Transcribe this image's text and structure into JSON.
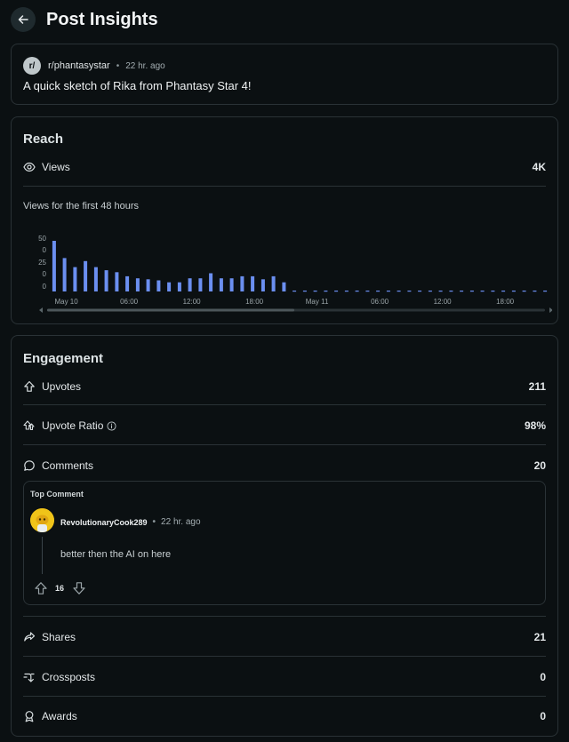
{
  "header": {
    "title": "Post Insights"
  },
  "post": {
    "subreddit": "r/phantasystar",
    "subreddit_icon": "r/",
    "separator": "•",
    "time": "22 hr. ago",
    "title": "A quick sketch of Rika from Phantasy Star 4!"
  },
  "reach": {
    "title": "Reach",
    "views_label": "Views",
    "views_value": "4K",
    "chart_caption": "Views for the first 48 hours"
  },
  "chart_data": {
    "type": "bar",
    "title": "Views for the first 48 hours",
    "y_ticks": [
      "50",
      "0",
      "25",
      "0",
      "0"
    ],
    "x_tick_labels": [
      "May 10",
      "06:00",
      "12:00",
      "18:00",
      "May 11",
      "06:00",
      "12:00",
      "18:00"
    ],
    "hours": 48,
    "values": [
      50,
      33,
      24,
      30,
      24,
      21,
      19,
      15,
      13,
      12,
      11,
      9,
      9,
      13,
      13,
      18,
      13,
      13,
      15,
      15,
      12,
      15,
      9,
      0,
      0,
      0,
      0,
      0,
      0,
      0,
      0,
      0,
      0,
      0,
      0,
      0,
      0,
      0,
      0,
      0,
      0,
      0,
      0,
      0,
      0,
      0,
      0,
      0
    ],
    "bar_color": "#6b8ff0",
    "grid": false
  },
  "engagement": {
    "title": "Engagement",
    "upvotes_label": "Upvotes",
    "upvotes_value": "211",
    "ratio_label": "Upvote Ratio",
    "ratio_value": "98%",
    "comments_label": "Comments",
    "comments_value": "20",
    "shares_label": "Shares",
    "shares_value": "21",
    "crossposts_label": "Crossposts",
    "crossposts_value": "0",
    "awards_label": "Awards",
    "awards_value": "0"
  },
  "top_comment": {
    "label": "Top Comment",
    "user": "RevolutionaryCook289",
    "separator": "•",
    "time": "22 hr. ago",
    "body": "better then the AI on here",
    "score": "16"
  },
  "colors": {
    "background": "#0b1012",
    "border": "#2a3236",
    "accent": "#6b8ff0"
  }
}
